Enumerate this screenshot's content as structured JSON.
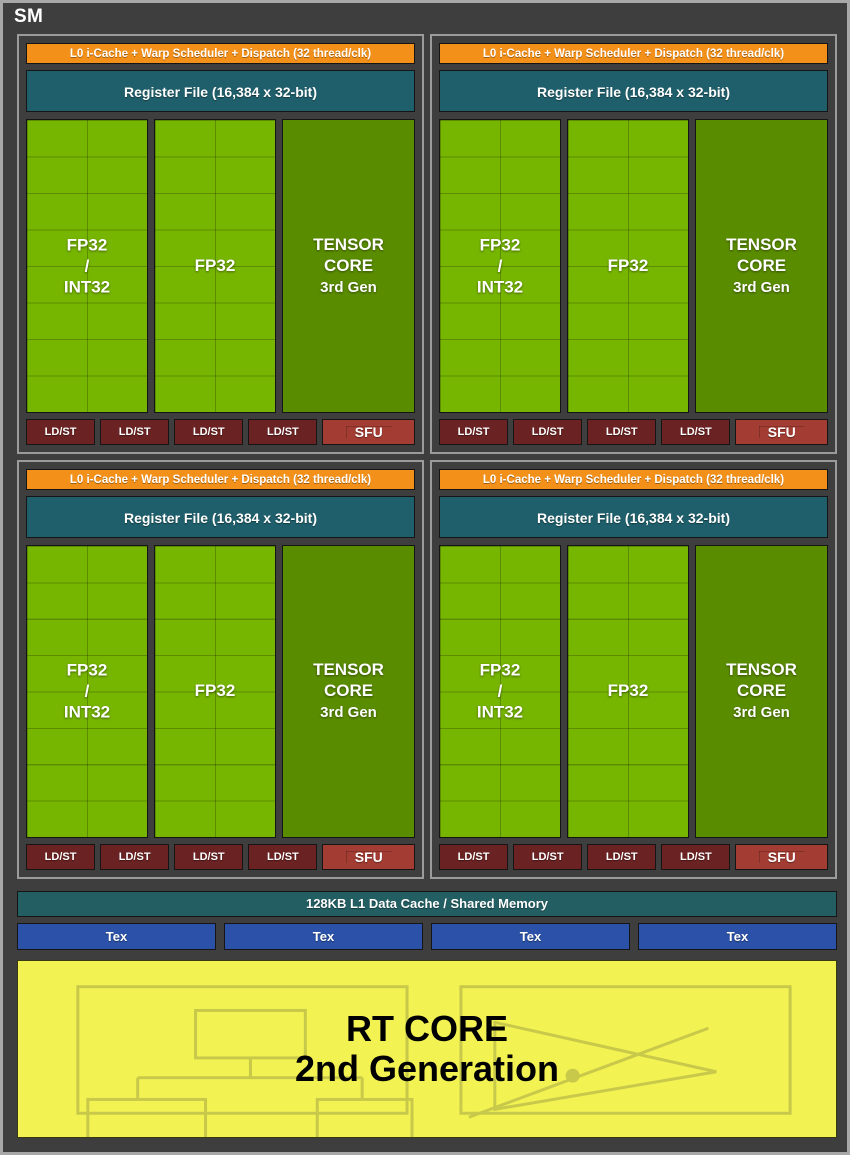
{
  "title": "SM",
  "colors": {
    "background": "#3e3e3e",
    "frame_border": "#a8a8a8",
    "partition_border": "#9b9b9b",
    "scheduler_orange": "#f39019",
    "register_file_teal": "#1f5f6b",
    "fp32_green": "#76b500",
    "tensor_green": "#5a8c00",
    "ldst_maroon": "#6b2222",
    "sfu_red": "#a33c32",
    "l1_cache_teal": "#235e63",
    "tex_blue": "#2b52a8",
    "rt_core_yellow": "#f2f253",
    "rt_core_icon_outline": "#c8c84a"
  },
  "partition": {
    "scheduler": "L0 i-Cache + Warp Scheduler + Dispatch (32 thread/clk)",
    "register_file": "Register File (16,384 x 32-bit)",
    "fp32_int32": {
      "line1": "FP32",
      "line2": "/",
      "line3": "INT32"
    },
    "fp32": "FP32",
    "tensor": {
      "line1": "TENSOR",
      "line2": "CORE",
      "line3": "3rd Gen"
    },
    "ldst": [
      "LD/ST",
      "LD/ST",
      "LD/ST",
      "LD/ST"
    ],
    "sfu": "SFU",
    "fp32_grid": {
      "columns": 2,
      "rows": 8,
      "cells": 16
    }
  },
  "partitions": [
    {
      "id": "partition-top-left"
    },
    {
      "id": "partition-top-right"
    },
    {
      "id": "partition-bottom-left"
    },
    {
      "id": "partition-bottom-right"
    }
  ],
  "l1_cache": "128KB L1 Data Cache / Shared Memory",
  "tex_units": [
    "Tex",
    "Tex",
    "Tex",
    "Tex"
  ],
  "rt_core": {
    "line1": "RT CORE",
    "line2": "2nd Generation",
    "icons": {
      "left": "bvh-tree-icon",
      "right": "ray-triangle-intersection-icon"
    }
  }
}
